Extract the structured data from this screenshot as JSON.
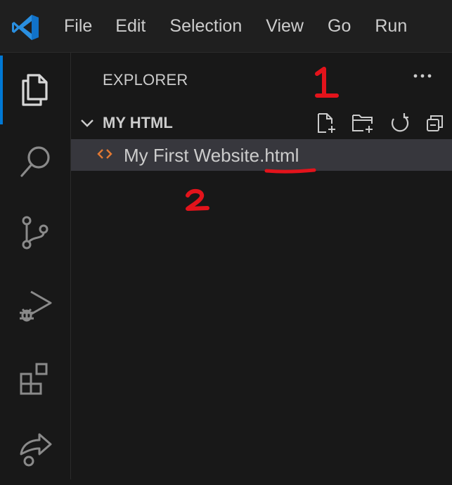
{
  "menubar": {
    "items": [
      "File",
      "Edit",
      "Selection",
      "View",
      "Go",
      "Run"
    ],
    "logo_icon": "vscode-logo"
  },
  "activity_bar": {
    "items": [
      {
        "icon": "files-icon",
        "active": true
      },
      {
        "icon": "search-icon",
        "active": false
      },
      {
        "icon": "source-control-icon",
        "active": false
      },
      {
        "icon": "run-debug-icon",
        "active": false
      },
      {
        "icon": "extensions-icon",
        "active": false
      },
      {
        "icon": "remote-explorer-icon",
        "active": false
      }
    ]
  },
  "sidebar": {
    "title": "EXPLORER",
    "more_icon": "ellipsis-icon",
    "section": {
      "title": "MY HTML",
      "actions": [
        "new-file-icon",
        "new-folder-icon",
        "refresh-icon",
        "collapse-all-icon"
      ]
    },
    "files": [
      {
        "name": "My First Website.html",
        "icon": "html-file-icon"
      }
    ]
  },
  "annotations": {
    "first": "1",
    "second": "2"
  },
  "colors": {
    "accent": "#0078d4",
    "annotation_red": "#e3131b",
    "html_icon": "#e37933",
    "selected_row": "#37373d"
  }
}
